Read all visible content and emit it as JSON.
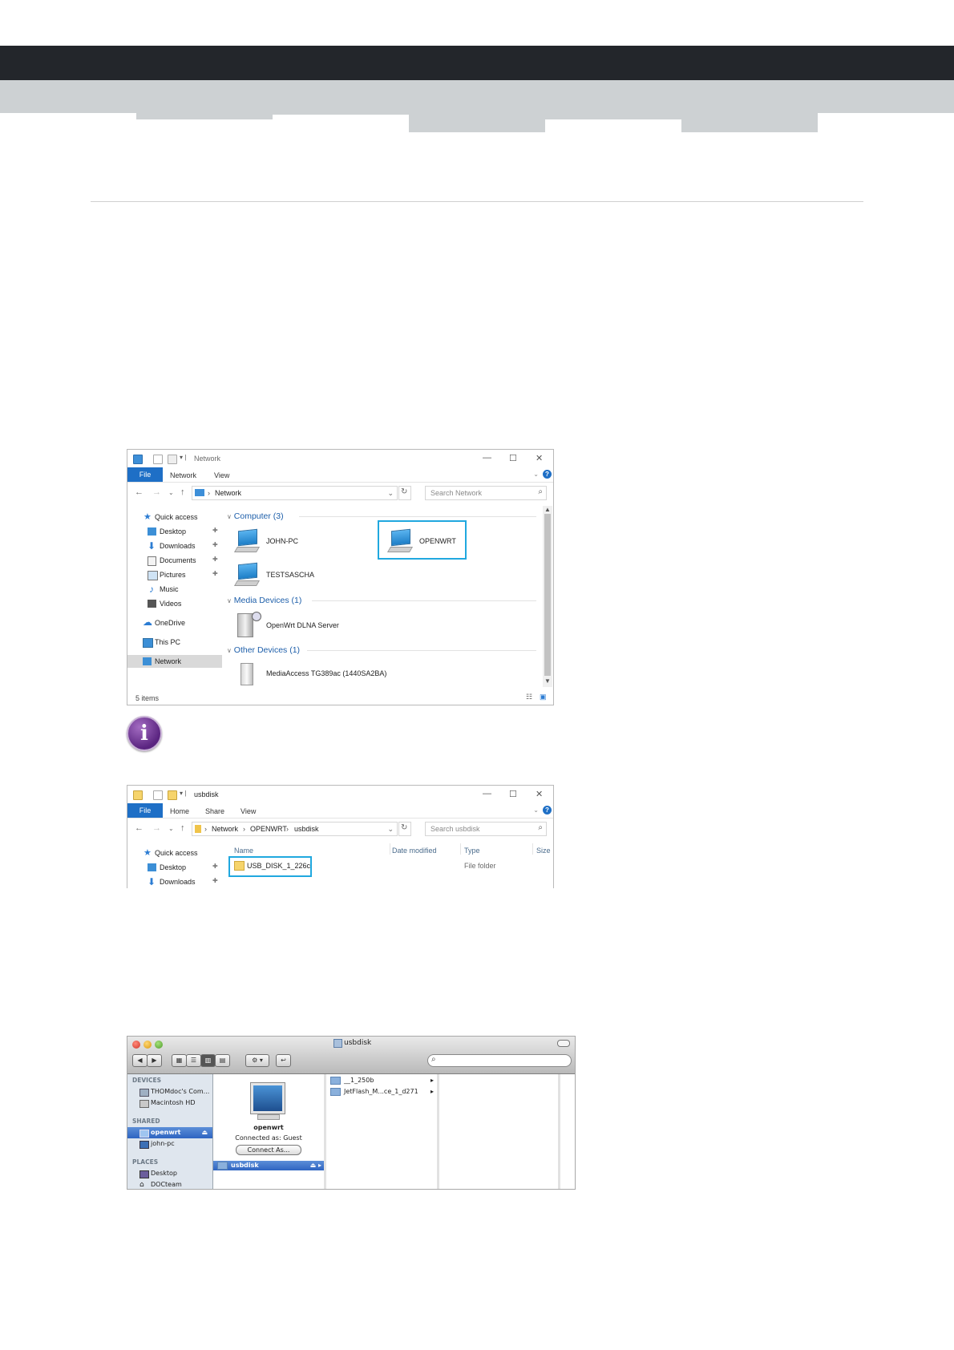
{
  "explorer1": {
    "title": "Network",
    "ribbon_tabs": [
      "File",
      "Network",
      "View"
    ],
    "address": "Network",
    "search_placeholder": "Search Network",
    "nav": [
      {
        "label": "Quick access",
        "pinned": false
      },
      {
        "label": "Desktop",
        "pinned": true
      },
      {
        "label": "Downloads",
        "pinned": true
      },
      {
        "label": "Documents",
        "pinned": true
      },
      {
        "label": "Pictures",
        "pinned": true
      },
      {
        "label": "Music",
        "pinned": false
      },
      {
        "label": "Videos",
        "pinned": false
      },
      {
        "label": "OneDrive",
        "pinned": false
      },
      {
        "label": "This PC",
        "pinned": false
      },
      {
        "label": "Network",
        "pinned": false
      }
    ],
    "groups": {
      "computer": "Computer (3)",
      "media": "Media Devices (1)",
      "other": "Other Devices (1)"
    },
    "items": {
      "john_pc": "JOHN-PC",
      "openwrt": "OPENWRT",
      "testsascha": "TESTSASCHA",
      "dlna": "OpenWrt DLNA Server",
      "mediaaccess": "MediaAccess TG389ac (1440SA2BA)"
    },
    "status": "5 items"
  },
  "explorer2": {
    "title": "usbdisk",
    "ribbon_tabs": [
      "File",
      "Home",
      "Share",
      "View"
    ],
    "breadcrumb": [
      "Network",
      "OPENWRT",
      "usbdisk"
    ],
    "search_placeholder": "Search usbdisk",
    "nav": [
      "Quick access",
      "Desktop",
      "Downloads"
    ],
    "columns": [
      "Name",
      "Date modified",
      "Type",
      "Size"
    ],
    "row": {
      "name": "USB_DISK_1_226c",
      "type": "File folder"
    }
  },
  "finder": {
    "title": "usbdisk",
    "sections": {
      "devices": "DEVICES",
      "shared": "SHARED",
      "places": "PLACES"
    },
    "devices": [
      "THOMdoc's Com...",
      "Macintosh HD"
    ],
    "shared": [
      "openwrt",
      "john-pc"
    ],
    "places": [
      "Desktop",
      "DOCteam"
    ],
    "server_name": "openwrt",
    "connected_as": "Connected as: Guest",
    "connect_button": "Connect As...",
    "share": "usbdisk",
    "folders": [
      "__1_250b",
      "JetFlash_M...ce_1_d271"
    ]
  },
  "colors": {
    "accent": "#1e6fc6",
    "highlight_box": "#20a8df",
    "header_dark": "#23262b",
    "header_band": "#cdd1d3",
    "info_icon": "#5a2480"
  }
}
